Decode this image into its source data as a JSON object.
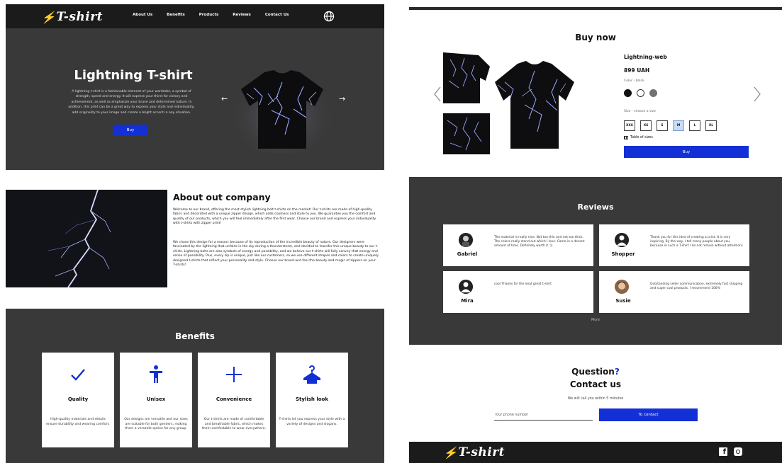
{
  "brand": {
    "logo_text": "T-shirt",
    "bolt": "⚡"
  },
  "nav": {
    "items": [
      "About Us",
      "Benefits",
      "Products",
      "Reviews",
      "Contact Us"
    ]
  },
  "hero": {
    "title": "Lightning T-shirt",
    "text": "A lightning t-shirt is a fashionable element of your wardrobe, a symbol of strength, speed and energy. It will express your thirst for victory and achievement, as well as emphasize your brave and determined nature. In addition, this print can be a great way to express your style and individuality, add originality to your image and create a bright accent in any situation.",
    "buy_label": "Buy",
    "prev_arrow": "←",
    "next_arrow": "→"
  },
  "about": {
    "title": "About out company",
    "p1": "Welcome to our brand, offering the most stylish lightning bolt t-shirts on the market! Our t-shirts are made of high-quality fabric and decorated with a unique zipper design, which adds coolness and style to you. We guarantee you the comfort and quality of our products, which you will feel immediately after the first wear. Choose our brand and express your individuality with t-shirts with zipper print!",
    "p2": "We chose this design for a reason: because of its reproduction of the incredible beauty of nature. Our designers were fascinated by the lightning that unfolds in the sky during a thunderstorm, and decided to transfer this unique beauty to our t-shirts. Lightning bolts are also symbols of energy and possibility, and we believe our t-shirts will fully convey that energy and sense of possibility. Plus, every zip is unique, just like our customers, so we use different shapes and colors to create uniquely designed t-shirts that reflect your personality and style. Choose our brand and feel the beauty and magic of zippers on your T-shirts!"
  },
  "benefits": {
    "title": "Benefits",
    "cards": [
      {
        "icon": "check-icon",
        "title": "Quality",
        "desc": "High-quality materials and details ensure durability and wearing comfort."
      },
      {
        "icon": "person-icon",
        "title": "Unisex",
        "desc": "Our designs are versatile and our sizes are suitable for both genders, making them a versatile option for any group."
      },
      {
        "icon": "plus-icon",
        "title": "Convenience",
        "desc": "Our t-shirts are made of comfortable and breathable fabric, which makes them comfortable to wear everywhere."
      },
      {
        "icon": "hanger-icon",
        "title": "Stylish look",
        "desc": "T-shirts let you express your style with a variety of designs and slogans."
      }
    ]
  },
  "product": {
    "section_title": "Buy now",
    "name": "Lightning-web",
    "price": "899 UAH",
    "color_label": "Color - black",
    "colors": [
      "#111111",
      "#ffffff",
      "#6e7570"
    ],
    "size_label": "Size - choose a size",
    "sizes": [
      "XXS",
      "XS",
      "S",
      "M",
      "L",
      "XL"
    ],
    "selected_size": "M",
    "table_of_sizes": "Table of sizes",
    "buy_label": "Buy"
  },
  "reviews": {
    "title": "Reviews",
    "items": [
      {
        "name": "Gabriel",
        "text": "The material is really nice. Not too thin and not too thick. The colors really stand out which I love. Came in a decent amount of time. Definitely worth it :))"
      },
      {
        "name": "Shopper",
        "text": "Thank you for this idea of creating a print. It is very inspiring. By the way, I tell many people about you, because in such a T-shirt I do not remain without attention)"
      },
      {
        "name": "Mira",
        "text": "cool Thanks for the neat great t-shirt"
      },
      {
        "name": "Susie",
        "text": "Outstanding seller communication, extremely fast shipping and super cool products. I recommend 100%"
      }
    ],
    "more_label": "More"
  },
  "contact": {
    "question": "Question",
    "question_mark": "?",
    "title": "Contact us",
    "subtitle": "We will call you within 5 minutes",
    "phone_placeholder": "Your phone number",
    "button_label": "To contact"
  },
  "colors": {
    "accent": "#1230d6",
    "dark": "#393939",
    "nav": "#1b1b1b"
  }
}
